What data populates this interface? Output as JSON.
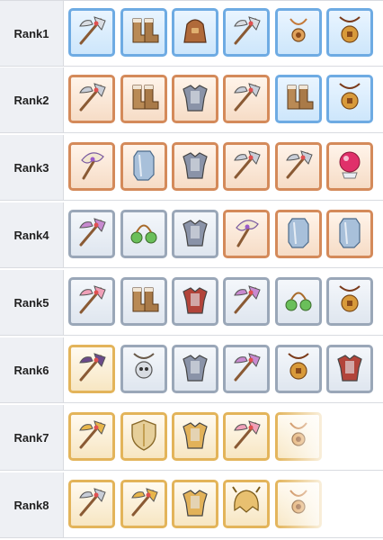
{
  "ranks": [
    {
      "label": "Rank1",
      "items": [
        {
          "icon": "axe-icon",
          "tier": "blue"
        },
        {
          "icon": "boots-icon",
          "tier": "blue"
        },
        {
          "icon": "bag-icon",
          "tier": "blue"
        },
        {
          "icon": "axe-icon",
          "tier": "blue"
        },
        {
          "icon": "amulet-icon",
          "tier": "blue"
        },
        {
          "icon": "coin-pendant-icon",
          "tier": "blue"
        }
      ]
    },
    {
      "label": "Rank2",
      "items": [
        {
          "icon": "battle-axe-icon",
          "tier": "copper"
        },
        {
          "icon": "boots-icon",
          "tier": "copper"
        },
        {
          "icon": "armor-icon",
          "tier": "copper"
        },
        {
          "icon": "battle-axe-icon",
          "tier": "copper"
        },
        {
          "icon": "boots-icon",
          "tier": "blue"
        },
        {
          "icon": "coin-pendant-icon",
          "tier": "blue"
        }
      ]
    },
    {
      "label": "Rank3",
      "items": [
        {
          "icon": "fan-staff-icon",
          "tier": "copper"
        },
        {
          "icon": "crystal-icon",
          "tier": "copper"
        },
        {
          "icon": "armor-icon",
          "tier": "copper"
        },
        {
          "icon": "battle-axe-icon",
          "tier": "copper"
        },
        {
          "icon": "battle-axe-icon",
          "tier": "copper"
        },
        {
          "icon": "crystal-ball-icon",
          "tier": "copper"
        }
      ]
    },
    {
      "label": "Rank4",
      "items": [
        {
          "icon": "winged-axe-icon",
          "tier": "silver"
        },
        {
          "icon": "beads-icon",
          "tier": "silver"
        },
        {
          "icon": "armor-icon",
          "tier": "silver"
        },
        {
          "icon": "fan-staff-icon",
          "tier": "copper"
        },
        {
          "icon": "crystal-icon",
          "tier": "copper"
        },
        {
          "icon": "crystal-icon",
          "tier": "copper"
        }
      ]
    },
    {
      "label": "Rank5",
      "items": [
        {
          "icon": "star-axe-icon",
          "tier": "silver"
        },
        {
          "icon": "boots-icon",
          "tier": "silver"
        },
        {
          "icon": "cape-armor-icon",
          "tier": "silver"
        },
        {
          "icon": "winged-axe-icon",
          "tier": "silver"
        },
        {
          "icon": "beads-icon",
          "tier": "silver"
        },
        {
          "icon": "coin-pendant-icon",
          "tier": "silver"
        }
      ]
    },
    {
      "label": "Rank6",
      "items": [
        {
          "icon": "dark-axe-icon",
          "tier": "gold"
        },
        {
          "icon": "skull-amulet-icon",
          "tier": "silver"
        },
        {
          "icon": "armor-icon",
          "tier": "silver"
        },
        {
          "icon": "winged-axe-icon",
          "tier": "silver"
        },
        {
          "icon": "coin-pendant-icon",
          "tier": "silver"
        },
        {
          "icon": "cape-armor-icon",
          "tier": "silver"
        }
      ]
    },
    {
      "label": "Rank7",
      "items": [
        {
          "icon": "gold-axe-icon",
          "tier": "gold"
        },
        {
          "icon": "shield-icon",
          "tier": "gold"
        },
        {
          "icon": "gold-armor-icon",
          "tier": "gold"
        },
        {
          "icon": "star-axe-icon",
          "tier": "gold"
        },
        {
          "icon": "amulet-icon",
          "tier": "gold"
        }
      ]
    },
    {
      "label": "Rank8",
      "items": [
        {
          "icon": "battle-axe-icon",
          "tier": "gold"
        },
        {
          "icon": "gold-axe-icon",
          "tier": "gold"
        },
        {
          "icon": "gold-armor-icon",
          "tier": "gold"
        },
        {
          "icon": "helmet-icon",
          "tier": "gold"
        },
        {
          "icon": "amulet-icon",
          "tier": "gold"
        }
      ]
    }
  ],
  "tier_colors": {
    "blue": "#6eabe3",
    "copper": "#d48a5a",
    "silver": "#9aa7b8",
    "gold": "#e3b45a"
  }
}
